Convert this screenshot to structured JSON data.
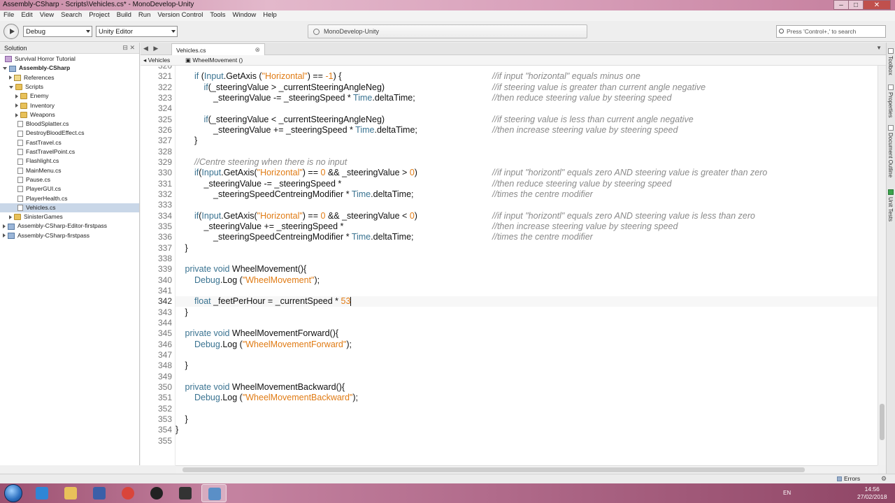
{
  "window": {
    "title": "Assembly-CSharp - Scripts\\Vehicles.cs* - MonoDevelop-Unity",
    "controls": [
      "–",
      "□",
      "✕"
    ]
  },
  "menu": [
    "File",
    "Edit",
    "View",
    "Search",
    "Project",
    "Build",
    "Run",
    "Version Control",
    "Tools",
    "Window",
    "Help"
  ],
  "toolbar": {
    "configuration": "Debug",
    "target": "Unity Editor",
    "status": "MonoDevelop-Unity",
    "search_placeholder": "Press 'Control+,' to search"
  },
  "solution": {
    "title": "Solution",
    "items": [
      {
        "label": "Survival Horror Tutorial",
        "depth": 0,
        "icon": "solution",
        "expander": "none"
      },
      {
        "label": "Assembly-CSharp",
        "depth": 0,
        "icon": "project",
        "expander": "expanded",
        "bold": true
      },
      {
        "label": "References",
        "depth": 1,
        "icon": "references",
        "expander": "collapsed"
      },
      {
        "label": "Scripts",
        "depth": 1,
        "icon": "folder",
        "expander": "expanded"
      },
      {
        "label": "Enemy",
        "depth": 2,
        "icon": "folder",
        "expander": "collapsed"
      },
      {
        "label": "Inventory",
        "depth": 2,
        "icon": "folder",
        "expander": "collapsed"
      },
      {
        "label": "Weapons",
        "depth": 2,
        "icon": "folder",
        "expander": "collapsed"
      },
      {
        "label": "BloodSplatter.cs",
        "depth": 2,
        "icon": "file",
        "expander": "none"
      },
      {
        "label": "DestroyBloodEffect.cs",
        "depth": 2,
        "icon": "file",
        "expander": "none"
      },
      {
        "label": "FastTravel.cs",
        "depth": 2,
        "icon": "file",
        "expander": "none"
      },
      {
        "label": "FastTravelPoint.cs",
        "depth": 2,
        "icon": "file",
        "expander": "none"
      },
      {
        "label": "Flashlight.cs",
        "depth": 2,
        "icon": "file",
        "expander": "none"
      },
      {
        "label": "MainMenu.cs",
        "depth": 2,
        "icon": "file",
        "expander": "none"
      },
      {
        "label": "Pause.cs",
        "depth": 2,
        "icon": "file",
        "expander": "none"
      },
      {
        "label": "PlayerGUI.cs",
        "depth": 2,
        "icon": "file",
        "expander": "none"
      },
      {
        "label": "PlayerHealth.cs",
        "depth": 2,
        "icon": "file",
        "expander": "none"
      },
      {
        "label": "Vehicles.cs",
        "depth": 2,
        "icon": "file",
        "expander": "none",
        "selected": true
      },
      {
        "label": "SinisterGames",
        "depth": 1,
        "icon": "folder",
        "expander": "collapsed"
      },
      {
        "label": "Assembly-CSharp-Editor-firstpass",
        "depth": 0,
        "icon": "project",
        "expander": "collapsed"
      },
      {
        "label": "Assembly-CSharp-firstpass",
        "depth": 0,
        "icon": "project",
        "expander": "collapsed"
      }
    ]
  },
  "editor": {
    "tab": "Vehicles.cs",
    "path": [
      "Vehicles",
      "WheelMovement ()"
    ],
    "current_line": "342",
    "lines": [
      {
        "n": "320",
        "indent": 0,
        "tokens": [],
        "comment": ""
      },
      {
        "n": "321",
        "indent": 2,
        "tokens": [
          [
            "kw",
            "if "
          ],
          [
            "t",
            "("
          ],
          [
            "type",
            "Input"
          ],
          [
            "t",
            ".GetAxis ("
          ],
          [
            "str",
            "\"Horizontal\""
          ],
          [
            "t",
            ") == "
          ],
          [
            "num",
            "-1"
          ],
          [
            "t",
            ") {"
          ]
        ],
        "comment": "//if input \"horizontal\" equals minus one"
      },
      {
        "n": "322",
        "indent": 3,
        "tokens": [
          [
            "kw",
            "if"
          ],
          [
            "t",
            "(_steeringValue > _currentSteeringAngleNeg)"
          ]
        ],
        "comment": "//if steering value is greater than current angle negative"
      },
      {
        "n": "323",
        "indent": 4,
        "tokens": [
          [
            "t",
            "_steeringValue -= _steeringSpeed * "
          ],
          [
            "type",
            "Time"
          ],
          [
            "t",
            ".deltaTime;"
          ]
        ],
        "comment": "//then reduce steering value by steering speed"
      },
      {
        "n": "324",
        "indent": 0,
        "tokens": [],
        "comment": ""
      },
      {
        "n": "325",
        "indent": 3,
        "tokens": [
          [
            "kw",
            "if"
          ],
          [
            "t",
            "(_steeringValue < _currentSteeringAngleNeg)"
          ]
        ],
        "comment": "//if steering value is less than current angle negative"
      },
      {
        "n": "326",
        "indent": 4,
        "tokens": [
          [
            "t",
            "_steeringValue += _steeringSpeed * "
          ],
          [
            "type",
            "Time"
          ],
          [
            "t",
            ".deltaTime;"
          ]
        ],
        "comment": "//then increase steering value by steering speed"
      },
      {
        "n": "327",
        "indent": 2,
        "tokens": [
          [
            "t",
            "}"
          ]
        ],
        "comment": ""
      },
      {
        "n": "328",
        "indent": 0,
        "tokens": [],
        "comment": ""
      },
      {
        "n": "329",
        "indent": 2,
        "tokens": [
          [
            "cmt",
            "//Centre steering when there is no input"
          ]
        ],
        "comment": ""
      },
      {
        "n": "330",
        "indent": 2,
        "tokens": [
          [
            "kw",
            "if"
          ],
          [
            "t",
            "("
          ],
          [
            "type",
            "Input"
          ],
          [
            "t",
            ".GetAxis("
          ],
          [
            "str",
            "\"Horizontal\""
          ],
          [
            "t",
            ") == "
          ],
          [
            "num",
            "0"
          ],
          [
            "t",
            " && _steeringValue > "
          ],
          [
            "num",
            "0"
          ],
          [
            "t",
            ")"
          ]
        ],
        "comment": "//if input \"horizontl\" equals zero AND steering value is greater than zero"
      },
      {
        "n": "331",
        "indent": 3,
        "tokens": [
          [
            "t",
            "_steeringValue -= _steeringSpeed *"
          ]
        ],
        "comment": "//then reduce steering value by steering speed"
      },
      {
        "n": "332",
        "indent": 4,
        "tokens": [
          [
            "t",
            "_steeringSpeedCentreingModifier * "
          ],
          [
            "type",
            "Time"
          ],
          [
            "t",
            ".deltaTime;"
          ]
        ],
        "comment": "//times the centre modifier"
      },
      {
        "n": "333",
        "indent": 0,
        "tokens": [],
        "comment": ""
      },
      {
        "n": "334",
        "indent": 2,
        "tokens": [
          [
            "kw",
            "if"
          ],
          [
            "t",
            "("
          ],
          [
            "type",
            "Input"
          ],
          [
            "t",
            ".GetAxis("
          ],
          [
            "str",
            "\"Horizontal\""
          ],
          [
            "t",
            ") == "
          ],
          [
            "num",
            "0"
          ],
          [
            "t",
            " && _steeringValue < "
          ],
          [
            "num",
            "0"
          ],
          [
            "t",
            ")"
          ]
        ],
        "comment": "//if input \"horizontl\" equals zero AND steering value is less than zero"
      },
      {
        "n": "335",
        "indent": 3,
        "tokens": [
          [
            "t",
            "_steeringValue += _steeringSpeed *"
          ]
        ],
        "comment": "//then increase steering value by steering speed"
      },
      {
        "n": "336",
        "indent": 4,
        "tokens": [
          [
            "t",
            "_steeringSpeedCentreingModifier * "
          ],
          [
            "type",
            "Time"
          ],
          [
            "t",
            ".deltaTime;"
          ]
        ],
        "comment": "//times the centre modifier"
      },
      {
        "n": "337",
        "indent": 1,
        "tokens": [
          [
            "t",
            "}"
          ]
        ],
        "comment": ""
      },
      {
        "n": "338",
        "indent": 0,
        "tokens": [],
        "comment": ""
      },
      {
        "n": "339",
        "indent": 1,
        "tokens": [
          [
            "kw",
            "private void "
          ],
          [
            "t",
            "WheelMovement(){"
          ]
        ],
        "comment": ""
      },
      {
        "n": "340",
        "indent": 2,
        "tokens": [
          [
            "type",
            "Debug"
          ],
          [
            "t",
            ".Log ("
          ],
          [
            "str",
            "\"WheelMovement\""
          ],
          [
            "t",
            ");"
          ]
        ],
        "comment": ""
      },
      {
        "n": "341",
        "indent": 0,
        "tokens": [],
        "comment": ""
      },
      {
        "n": "342",
        "indent": 2,
        "tokens": [
          [
            "kw",
            "float "
          ],
          [
            "t",
            "_feetPerHour = _currentSpeed * "
          ],
          [
            "num",
            "53"
          ],
          [
            "caret",
            ""
          ]
        ],
        "comment": ""
      },
      {
        "n": "343",
        "indent": 1,
        "tokens": [
          [
            "t",
            "}"
          ]
        ],
        "comment": ""
      },
      {
        "n": "344",
        "indent": 0,
        "tokens": [],
        "comment": ""
      },
      {
        "n": "345",
        "indent": 1,
        "tokens": [
          [
            "kw",
            "private void "
          ],
          [
            "t",
            "WheelMovementForward(){"
          ]
        ],
        "comment": ""
      },
      {
        "n": "346",
        "indent": 2,
        "tokens": [
          [
            "type",
            "Debug"
          ],
          [
            "t",
            ".Log ("
          ],
          [
            "str",
            "\"WheelMovementForward\""
          ],
          [
            "t",
            ");"
          ]
        ],
        "comment": ""
      },
      {
        "n": "347",
        "indent": 0,
        "tokens": [],
        "comment": ""
      },
      {
        "n": "348",
        "indent": 1,
        "tokens": [
          [
            "t",
            "}"
          ]
        ],
        "comment": ""
      },
      {
        "n": "349",
        "indent": 0,
        "tokens": [],
        "comment": ""
      },
      {
        "n": "350",
        "indent": 1,
        "tokens": [
          [
            "kw",
            "private void "
          ],
          [
            "t",
            "WheelMovementBackward(){"
          ]
        ],
        "comment": ""
      },
      {
        "n": "351",
        "indent": 2,
        "tokens": [
          [
            "type",
            "Debug"
          ],
          [
            "t",
            ".Log ("
          ],
          [
            "str",
            "\"WheelMovementBackward\""
          ],
          [
            "t",
            ");"
          ]
        ],
        "comment": ""
      },
      {
        "n": "352",
        "indent": 0,
        "tokens": [],
        "comment": ""
      },
      {
        "n": "353",
        "indent": 1,
        "tokens": [
          [
            "t",
            "}"
          ]
        ],
        "comment": ""
      },
      {
        "n": "354",
        "indent": 0,
        "tokens": [
          [
            "t",
            "}"
          ]
        ],
        "comment": ""
      },
      {
        "n": "355",
        "indent": 0,
        "tokens": [],
        "comment": ""
      }
    ]
  },
  "right_dock": [
    "Toolbox",
    "Properties",
    "Document Outline",
    "Unit Tests"
  ],
  "statusbar": {
    "errors": "Errors"
  },
  "taskbar": {
    "apps": [
      {
        "icon": "internet-explorer-icon",
        "color": "#2f86d6"
      },
      {
        "icon": "file-explorer-icon",
        "color": "#e8c15a"
      },
      {
        "icon": "media-player-icon",
        "color": "#3b5fa8"
      },
      {
        "icon": "chrome-icon",
        "color": "#d9453b"
      },
      {
        "icon": "obs-icon",
        "color": "#222222"
      },
      {
        "icon": "unity-icon",
        "color": "#333333"
      },
      {
        "icon": "monodevelop-icon",
        "color": "#5a8fc7",
        "active": true
      }
    ],
    "language": "EN",
    "time": "14:56",
    "date": "27/02/2018"
  }
}
